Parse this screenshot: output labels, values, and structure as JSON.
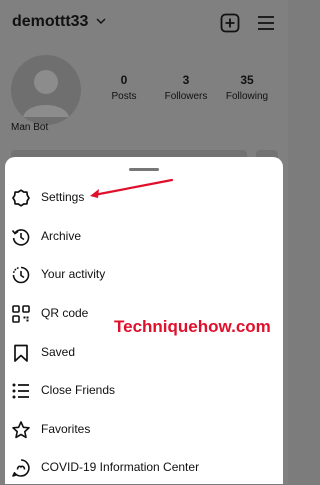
{
  "header": {
    "username": "demottt33"
  },
  "profile": {
    "display_name": "Man Bot",
    "stats": [
      {
        "value": "0",
        "label": "Posts"
      },
      {
        "value": "3",
        "label": "Followers"
      },
      {
        "value": "35",
        "label": "Following"
      }
    ]
  },
  "menu": {
    "items": [
      {
        "label": "Settings",
        "icon": "settings-gear-icon"
      },
      {
        "label": "Archive",
        "icon": "archive-history-icon"
      },
      {
        "label": "Your activity",
        "icon": "activity-clock-icon"
      },
      {
        "label": "QR code",
        "icon": "qr-code-icon"
      },
      {
        "label": "Saved",
        "icon": "bookmark-icon"
      },
      {
        "label": "Close Friends",
        "icon": "close-friends-list-icon"
      },
      {
        "label": "Favorites",
        "icon": "star-icon"
      },
      {
        "label": "COVID-19 Information Center",
        "icon": "covid-info-icon"
      }
    ]
  },
  "overlay": {
    "watermark": "Techniquehow.com"
  },
  "colors": {
    "accent_red": "#e0102c",
    "dim_overlay": "#808080",
    "sheet": "#ffffff"
  }
}
